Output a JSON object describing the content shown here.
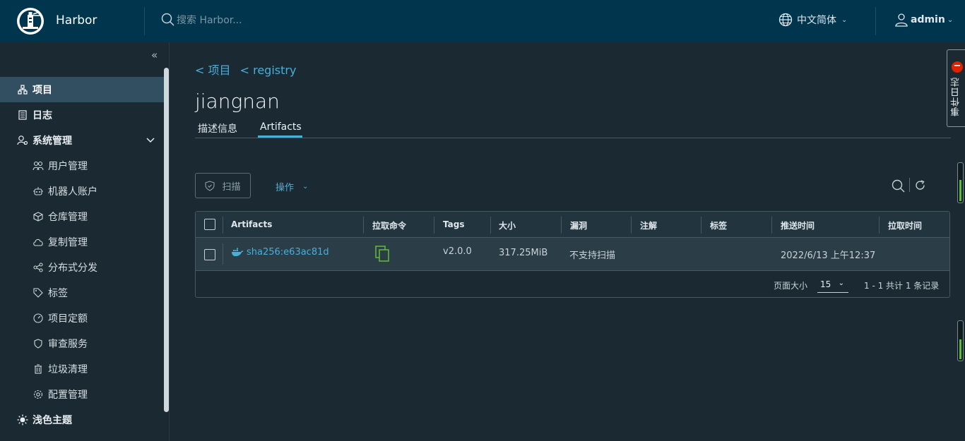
{
  "header": {
    "brand": "Harbor",
    "search_placeholder": "搜索 Harbor...",
    "language": "中文简体",
    "user": "admin"
  },
  "sidebar": {
    "items": [
      {
        "label": "项目",
        "icon": "projects-icon",
        "active": true
      },
      {
        "label": "日志",
        "icon": "log-icon"
      },
      {
        "label": "系统管理",
        "icon": "admin-icon",
        "expanded": true
      }
    ],
    "sub_items": [
      {
        "label": "用户管理",
        "icon": "users-icon"
      },
      {
        "label": "机器人账户",
        "icon": "robot-icon"
      },
      {
        "label": "仓库管理",
        "icon": "registry-icon"
      },
      {
        "label": "复制管理",
        "icon": "replication-icon"
      },
      {
        "label": "分布式分发",
        "icon": "share-icon"
      },
      {
        "label": "标签",
        "icon": "tag-icon"
      },
      {
        "label": "项目定额",
        "icon": "quota-icon"
      },
      {
        "label": "审查服务",
        "icon": "shield-icon"
      },
      {
        "label": "垃圾清理",
        "icon": "trash-icon"
      },
      {
        "label": "配置管理",
        "icon": "gear-icon"
      }
    ],
    "theme": {
      "label": "浅色主题",
      "icon": "sun-icon"
    }
  },
  "breadcrumb": {
    "first": "< 项目",
    "second": "< registry"
  },
  "page_title": "jiangnan",
  "tabs": [
    {
      "label": "描述信息"
    },
    {
      "label": "Artifacts",
      "active": true
    }
  ],
  "toolbar": {
    "scan_label": "扫描",
    "ops_label": "操作"
  },
  "table": {
    "columns": [
      "Artifacts",
      "拉取命令",
      "Tags",
      "大小",
      "漏洞",
      "注解",
      "标签",
      "推送时间",
      "拉取时间"
    ],
    "rows": [
      {
        "digest": "sha256:e63ac81d",
        "tags": "v2.0.0",
        "size": "317.25MiB",
        "vulnerability": "不支持扫描",
        "annotations": "",
        "labels": "",
        "push_time": "2022/6/13 上午12:37",
        "pull_time": ""
      }
    ],
    "footer": {
      "page_size_label": "页面大小",
      "page_size": "15",
      "total": "1 - 1 共计 1 条记录"
    }
  },
  "event_log": {
    "label": "事件日志",
    "badge": "−"
  },
  "colors": {
    "header_bg": "#00354e",
    "body_bg": "#1b2a32",
    "accent": "#49afd9",
    "copy_icon": "#5fbf3a",
    "badge": "#e12200"
  }
}
